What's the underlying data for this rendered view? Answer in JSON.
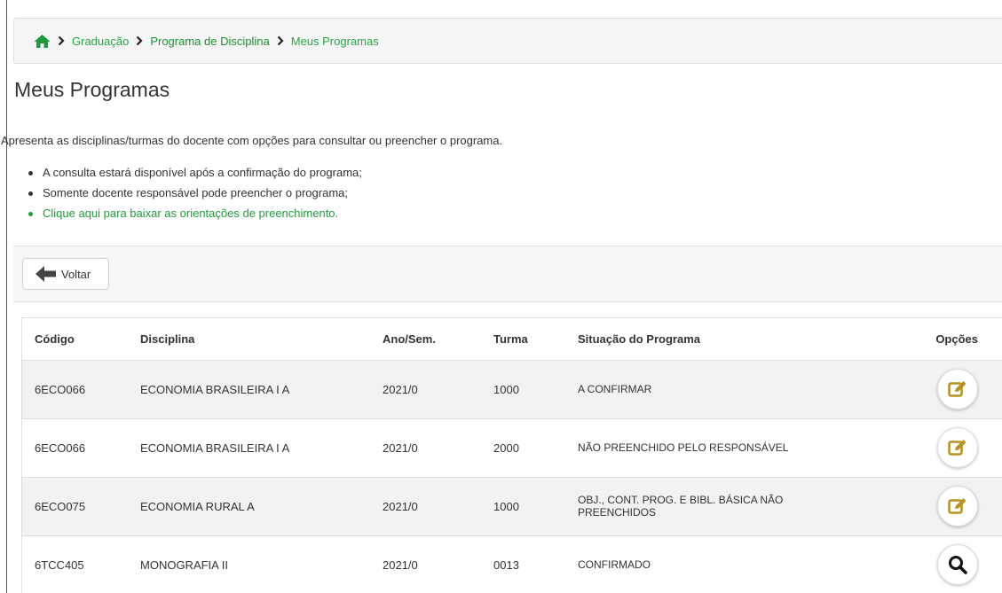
{
  "breadcrumb": {
    "home_icon": "home-icon",
    "items": [
      "Graduação",
      "Programa de Disciplina",
      "Meus Programas"
    ]
  },
  "page": {
    "title": "Meus Programas",
    "description": "Apresenta as disciplinas/turmas do docente com opções para consultar ou preencher o programa.",
    "bullets": [
      "A consulta estará disponível após a confirmação do programa;",
      "Somente docente responsável pode preencher o programa;",
      "Clique aqui para baixar as orientações de preenchimento."
    ]
  },
  "toolbar": {
    "back_label": "Voltar",
    "back_icon": "arrow-left-icon"
  },
  "table": {
    "headers": [
      "Código",
      "Disciplina",
      "Ano/Sem.",
      "Turma",
      "Situação do Programa",
      "Opções"
    ],
    "rows": [
      {
        "codigo": "6ECO066",
        "disciplina": "ECONOMIA BRASILEIRA I A",
        "ano_sem": "2021/0",
        "turma": "1000",
        "situacao": "A CONFIRMAR",
        "option_icon": "edit-icon"
      },
      {
        "codigo": "6ECO066",
        "disciplina": "ECONOMIA BRASILEIRA I A",
        "ano_sem": "2021/0",
        "turma": "2000",
        "situacao": "NÃO PREENCHIDO PELO RESPONSÁVEL",
        "option_icon": "edit-icon"
      },
      {
        "codigo": "6ECO075",
        "disciplina": "ECONOMIA RURAL A",
        "ano_sem": "2021/0",
        "turma": "1000",
        "situacao": "OBJ., CONT. PROG. E BIBL. BÁSICA NÃO PREENCHIDOS",
        "option_icon": "edit-icon"
      },
      {
        "codigo": "6TCC405",
        "disciplina": "MONOGRAFIA II",
        "ano_sem": "2021/0",
        "turma": "0013",
        "situacao": "CONFIRMADO",
        "option_icon": "search-icon"
      }
    ]
  },
  "colors": {
    "link_green": "#28a745",
    "edit_icon": "#b8911f",
    "breadcrumb_bg": "#f5f5f5"
  }
}
